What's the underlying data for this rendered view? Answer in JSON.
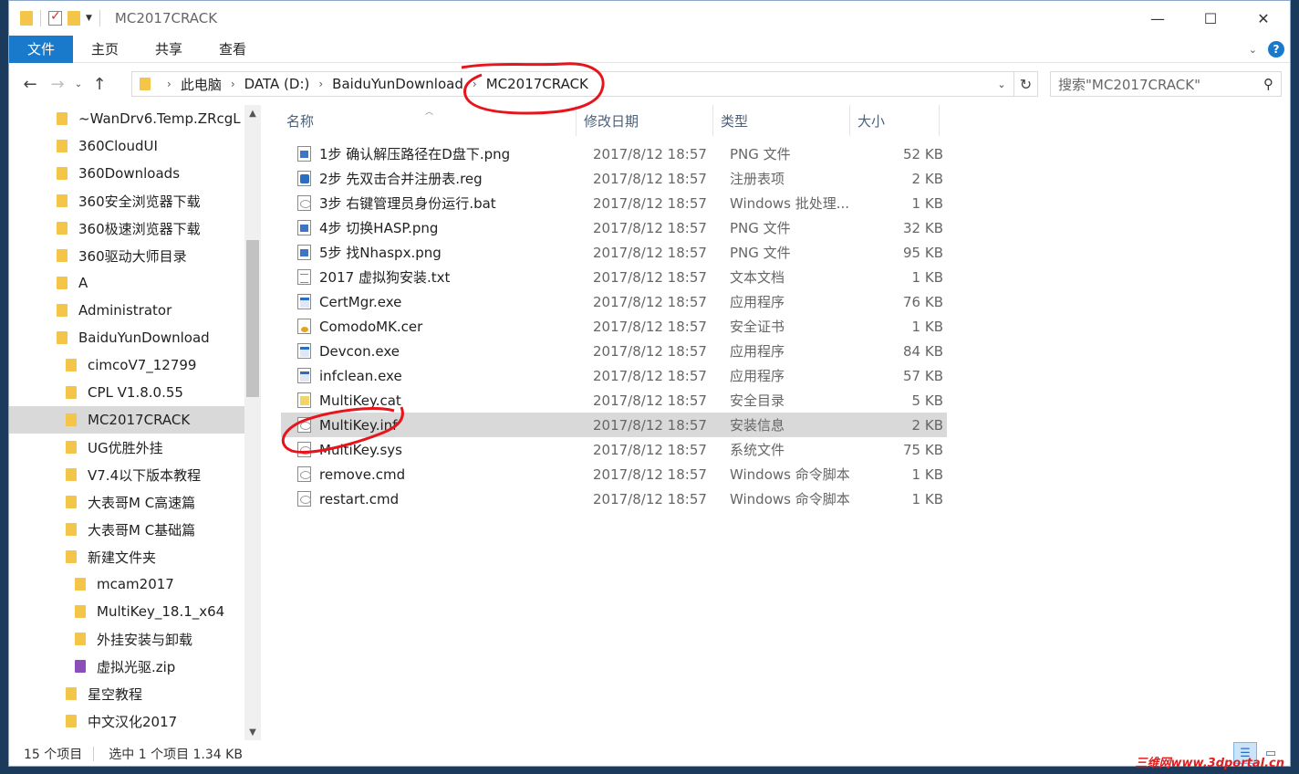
{
  "window": {
    "title": "MC2017CRACK"
  },
  "ribbon": {
    "tabs": [
      "文件",
      "主页",
      "共享",
      "查看"
    ]
  },
  "address": {
    "crumbs": [
      "此电脑",
      "DATA (D:)",
      "BaiduYunDownload",
      "MC2017CRACK"
    ],
    "search_placeholder": "搜索\"MC2017CRACK\""
  },
  "nav": {
    "items": [
      {
        "label": "~WanDrv6.Temp.ZRcgL",
        "indent": 0
      },
      {
        "label": "360CloudUI",
        "indent": 0
      },
      {
        "label": "360Downloads",
        "indent": 0
      },
      {
        "label": "360安全浏览器下载",
        "indent": 0
      },
      {
        "label": "360极速浏览器下载",
        "indent": 0
      },
      {
        "label": "360驱动大师目录",
        "indent": 0
      },
      {
        "label": "A",
        "indent": 0
      },
      {
        "label": "Administrator",
        "indent": 0
      },
      {
        "label": "BaiduYunDownload",
        "indent": 0
      },
      {
        "label": "cimcoV7_12799",
        "indent": 1
      },
      {
        "label": "CPL V1.8.0.55",
        "indent": 1
      },
      {
        "label": "MC2017CRACK",
        "indent": 1,
        "selected": true
      },
      {
        "label": "UG优胜外挂",
        "indent": 1
      },
      {
        "label": "V7.4以下版本教程",
        "indent": 1
      },
      {
        "label": "大表哥M C高速篇",
        "indent": 1
      },
      {
        "label": "大表哥M C基础篇",
        "indent": 1
      },
      {
        "label": "新建文件夹",
        "indent": 1
      },
      {
        "label": "mcam2017",
        "indent": 2
      },
      {
        "label": "MultiKey_18.1_x64",
        "indent": 2
      },
      {
        "label": "外挂安装与卸载",
        "indent": 2
      },
      {
        "label": "虚拟光驱.zip",
        "indent": 2,
        "zip": true
      },
      {
        "label": "星空教程",
        "indent": 1
      },
      {
        "label": "中文汉化2017",
        "indent": 1
      }
    ]
  },
  "columns": {
    "name": "名称",
    "date": "修改日期",
    "type": "类型",
    "size": "大小"
  },
  "files": [
    {
      "name": "1步 确认解压路径在D盘下.png",
      "date": "2017/8/12 18:57",
      "type": "PNG 文件",
      "size": "52 KB",
      "icon": "png"
    },
    {
      "name": "2步 先双击合并注册表.reg",
      "date": "2017/8/12 18:57",
      "type": "注册表项",
      "size": "2 KB",
      "icon": "reg"
    },
    {
      "name": "3步 右键管理员身份运行.bat",
      "date": "2017/8/12 18:57",
      "type": "Windows 批处理...",
      "size": "1 KB",
      "icon": "bat"
    },
    {
      "name": "4步 切换HASP.png",
      "date": "2017/8/12 18:57",
      "type": "PNG 文件",
      "size": "32 KB",
      "icon": "png"
    },
    {
      "name": "5步 找Nhaspx.png",
      "date": "2017/8/12 18:57",
      "type": "PNG 文件",
      "size": "95 KB",
      "icon": "png"
    },
    {
      "name": "2017 虚拟狗安装.txt",
      "date": "2017/8/12 18:57",
      "type": "文本文档",
      "size": "1 KB",
      "icon": "txt"
    },
    {
      "name": "CertMgr.exe",
      "date": "2017/8/12 18:57",
      "type": "应用程序",
      "size": "76 KB",
      "icon": "exe"
    },
    {
      "name": "ComodoMK.cer",
      "date": "2017/8/12 18:57",
      "type": "安全证书",
      "size": "1 KB",
      "icon": "cer"
    },
    {
      "name": "Devcon.exe",
      "date": "2017/8/12 18:57",
      "type": "应用程序",
      "size": "84 KB",
      "icon": "exe"
    },
    {
      "name": "infclean.exe",
      "date": "2017/8/12 18:57",
      "type": "应用程序",
      "size": "57 KB",
      "icon": "exe"
    },
    {
      "name": "MultiKey.cat",
      "date": "2017/8/12 18:57",
      "type": "安全目录",
      "size": "5 KB",
      "icon": "cat"
    },
    {
      "name": "MultiKey.inf",
      "date": "2017/8/12 18:57",
      "type": "安装信息",
      "size": "2 KB",
      "icon": "inf",
      "selected": true
    },
    {
      "name": "MultiKey.sys",
      "date": "2017/8/12 18:57",
      "type": "系统文件",
      "size": "75 KB",
      "icon": "sys"
    },
    {
      "name": "remove.cmd",
      "date": "2017/8/12 18:57",
      "type": "Windows 命令脚本",
      "size": "1 KB",
      "icon": "bat"
    },
    {
      "name": "restart.cmd",
      "date": "2017/8/12 18:57",
      "type": "Windows 命令脚本",
      "size": "1 KB",
      "icon": "bat"
    }
  ],
  "status": {
    "count": "15 个项目",
    "selection": "选中 1 个项目  1.34 KB"
  },
  "watermark": "三维网www.3dportal.cn",
  "colors": {
    "file_tab": "#1979ca",
    "selection": "#d9d9d9",
    "annotation": "#e8141b",
    "folder": "#f3c64a"
  }
}
